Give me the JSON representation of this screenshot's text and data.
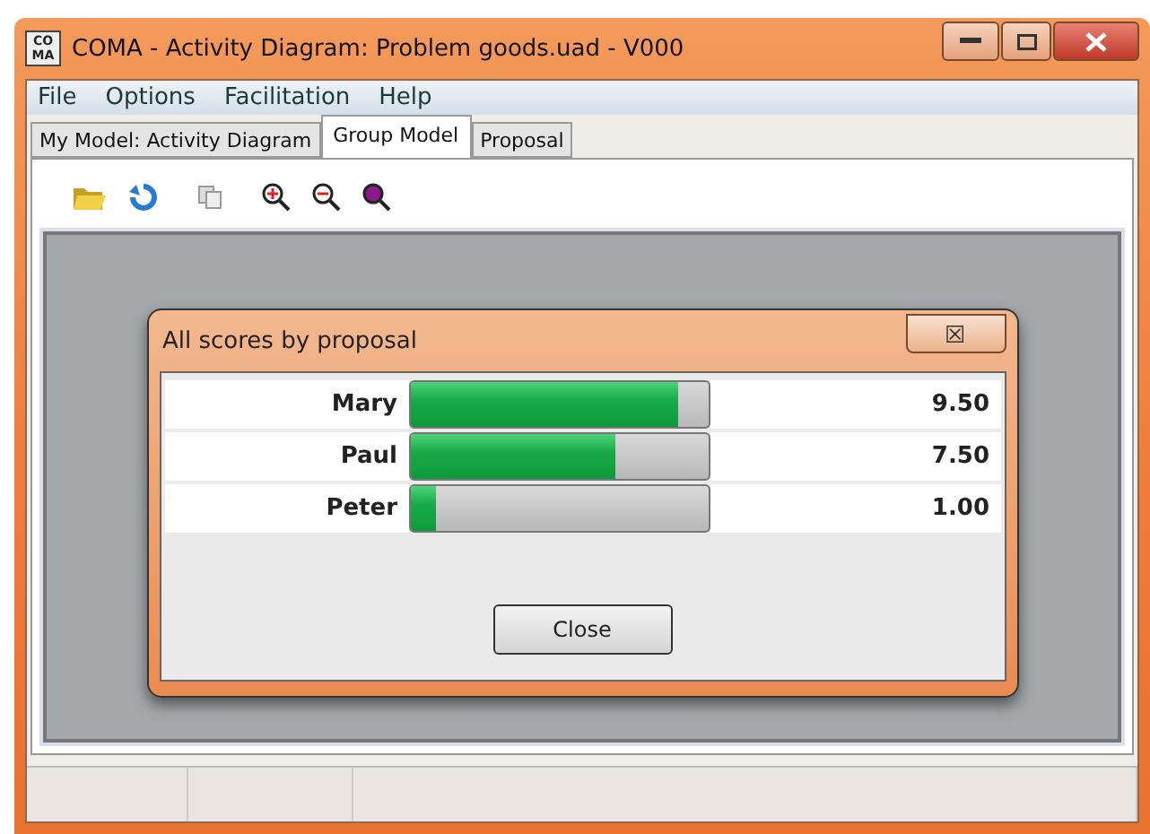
{
  "window": {
    "title": "COMA - Activity Diagram: Problem goods.uad - V000",
    "app_icon": "CO MA"
  },
  "menu": [
    "File",
    "Options",
    "Facilitation",
    "Help"
  ],
  "tabs": [
    {
      "label": "My Model: Activity Diagram",
      "selected": false
    },
    {
      "label": "Group Model",
      "selected": true
    },
    {
      "label": "Proposal",
      "selected": false
    }
  ],
  "dialog": {
    "title": "All scores by proposal",
    "close_glyph": "☒",
    "rows": [
      {
        "name": "Mary",
        "level": 0.9,
        "score": "9.50"
      },
      {
        "name": "Paul",
        "level": 0.69,
        "score": "7.50"
      },
      {
        "name": "Peter",
        "level": 0.09,
        "score": "1.00"
      }
    ],
    "button": "Close"
  }
}
